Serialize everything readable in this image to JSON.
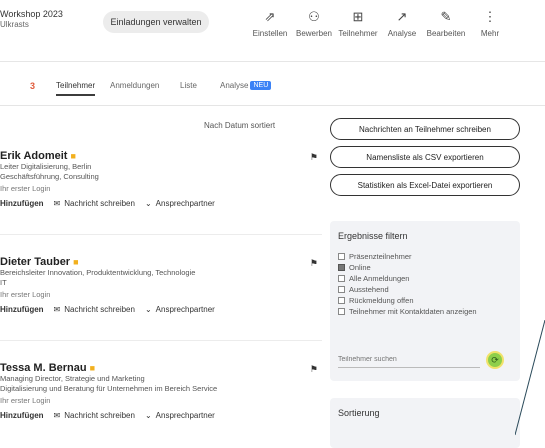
{
  "header": {
    "event_title": "Workshop 2023",
    "event_sub": "Ulkrasts",
    "share_label": "Einladungen verwalten",
    "actions": [
      {
        "icon": "share-icon",
        "glyph": "⇗",
        "label": "Einstellen"
      },
      {
        "icon": "people-icon",
        "glyph": "⚇",
        "label": "Bewerben"
      },
      {
        "icon": "table-icon",
        "glyph": "⊞",
        "label": "Teilnehmer"
      },
      {
        "icon": "analytics-icon",
        "glyph": "↗",
        "label": "Analyse"
      },
      {
        "icon": "edit-icon",
        "glyph": "✎",
        "label": "Bearbeiten"
      },
      {
        "icon": "more-icon",
        "glyph": "⋮",
        "label": "Mehr"
      }
    ]
  },
  "tabs": {
    "count": "3",
    "items": [
      {
        "label": "Teilnehmer",
        "active": true
      },
      {
        "label": "Anmeldungen",
        "active": false
      },
      {
        "label": "Liste",
        "active": false
      },
      {
        "label": "Analyse",
        "active": false,
        "badge": "NEU"
      }
    ]
  },
  "list": {
    "sort_label": "Nach Datum sortiert",
    "attendees": [
      {
        "name": "Erik Adomeit",
        "line1": "Leiter Digitalisierung, Berlin",
        "line2": "Geschäftsführung, Consulting",
        "date": "Ihr erster Login",
        "actions": [
          "Hinzufügen",
          "Nachricht schreiben",
          "Ansprechpartner"
        ]
      },
      {
        "name": "Dieter Tauber",
        "line1": "Bereichsleiter Innovation, Produktentwicklung, Technologie",
        "line2": "IT",
        "date": "Ihr erster Login",
        "actions": [
          "Hinzufügen",
          "Nachricht schreiben",
          "Ansprechpartner"
        ]
      },
      {
        "name": "Tessa M. Bernau",
        "line1": "Managing Director, Strategie und Marketing",
        "line2": "Digitalisierung und Beratung für Unternehmen im Bereich Service",
        "date": "Ihr erster Login",
        "actions": [
          "Hinzufügen",
          "Nachricht schreiben",
          "Ansprechpartner"
        ]
      }
    ]
  },
  "sidebar": {
    "export_buttons": [
      "Nachrichten an Teilnehmer schreiben",
      "Namensliste als CSV exportieren",
      "Statistiken als Excel-Datei exportieren"
    ],
    "filter": {
      "title": "Ergebnisse filtern",
      "options": [
        {
          "label": "Präsenzteilnehmer",
          "checked": false
        },
        {
          "label": "Online",
          "checked": true
        },
        {
          "label": "Alle Anmeldungen",
          "checked": false
        },
        {
          "label": "Ausstehend",
          "checked": false
        },
        {
          "label": "Rückmeldung offen",
          "checked": false
        },
        {
          "label": "Teilnehmer mit Kontaktdaten anzeigen",
          "checked": false
        }
      ],
      "search_placeholder": "Teilnehmer suchen"
    },
    "sort_title": "Sortierung"
  }
}
